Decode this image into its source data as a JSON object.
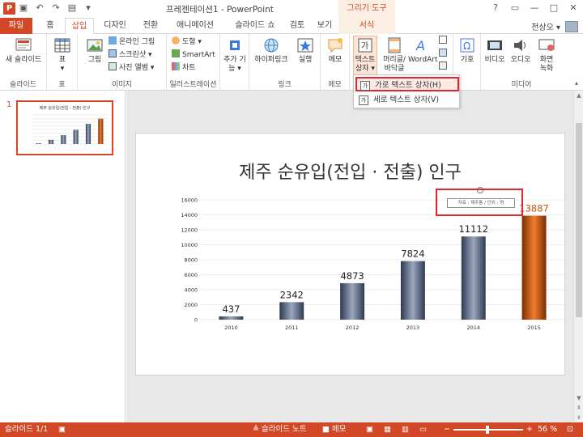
{
  "window": {
    "title": "프레젠테이션1 - PowerPoint",
    "context_tool_title": "그리기 도구",
    "app_icon_letter": "P",
    "controls": [
      "?",
      "▭",
      "—",
      "□",
      "✕"
    ]
  },
  "tabs": {
    "file": "파일",
    "home": "홈",
    "insert": "삽입",
    "design": "디자인",
    "transitions": "전환",
    "animations": "애니메이션",
    "slideshow": "슬라이드 쇼",
    "review": "검토",
    "view": "보기",
    "format": "서식",
    "user": "전상오 ▾"
  },
  "ribbon": {
    "new_slide": "새 슬라이드",
    "group_slides": "슬라이드",
    "table": "표",
    "group_table": "표",
    "picture": "그림",
    "online_picture": "온라인 그림",
    "screenshot": "스크린샷 ▾",
    "photo_album": "사진 앨범 ▾",
    "group_images": "이미지",
    "shapes": "도형 ▾",
    "smartart": "SmartArt",
    "chart": "차트",
    "group_illustrations": "일러스트레이션",
    "addins_line1": "추가 기",
    "addins_line2": "능 ▾",
    "hyperlink": "하이퍼링크",
    "action": "실행",
    "group_links": "링크",
    "comment": "메모",
    "group_comments": "메모",
    "textbox_line1": "텍스트",
    "textbox_line2": "상자 ▾",
    "header_footer_line1": "머리글/",
    "header_footer_line2": "바닥글",
    "wordart": "WordArt",
    "symbols": "기호",
    "video": "비디오",
    "audio": "오디오",
    "screen_rec_line1": "화면",
    "screen_rec_line2": "녹화",
    "group_media": "미디어"
  },
  "dropdown": {
    "horizontal_textbox": "가로 텍스트 상자(H)",
    "vertical_textbox": "세로 텍스트 상자(V)"
  },
  "slides_panel": {
    "slide_number": "1",
    "thumb_title": "제주 순유입(전입 - 전출) 인구"
  },
  "slide": {
    "title": "제주 순유입(전입 · 전출) 인구",
    "source_note": "자료 : 제주통 / 단위 : 명"
  },
  "chart_data": {
    "type": "bar",
    "title": "제주 순유입(전입 · 전출) 인구",
    "categories": [
      "2010",
      "2011",
      "2012",
      "2013",
      "2014",
      "2015"
    ],
    "values": [
      437,
      2342,
      4873,
      7824,
      11112,
      13887
    ],
    "ylim": [
      0,
      16000
    ],
    "yticks": [
      0,
      2000,
      4000,
      6000,
      8000,
      10000,
      12000,
      14000,
      16000
    ],
    "grid": true,
    "colors": {
      "default": "#4a5a78",
      "highlight": "#c8540e"
    },
    "highlight_index": 5
  },
  "status": {
    "slide_info": "슬라이드 1/1",
    "notes": "≜ 슬라이드 노트",
    "comments": "■ 메모",
    "zoom": "56 %"
  }
}
